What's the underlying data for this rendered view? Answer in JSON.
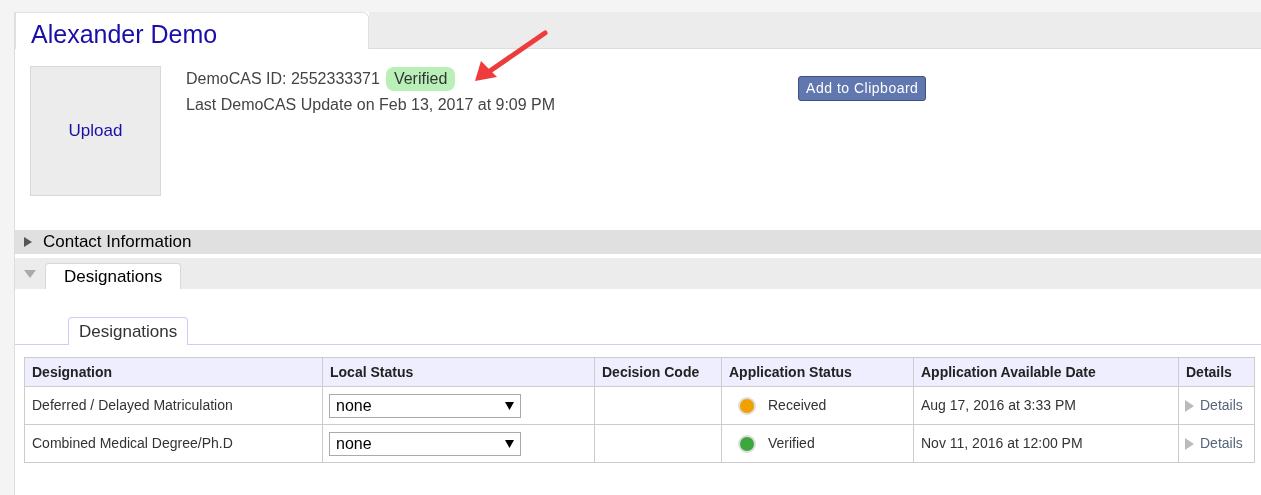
{
  "profile": {
    "name": "Alexander Demo",
    "upload": "Upload",
    "id_label": "DemoCAS ID: 2552333371",
    "id_status": "Verified",
    "last_update": "Last DemoCAS Update on Feb 13, 2017 at 9:09 PM",
    "clipboard_button": "Add to Clipboard"
  },
  "sections": [
    {
      "title": "Contact Information",
      "expanded": false
    },
    {
      "title": "Designations",
      "expanded": true
    }
  ],
  "tabs": [
    {
      "label": "Designations",
      "selected": true
    }
  ],
  "table": {
    "columns": [
      "Designation",
      "Local Status",
      "Decision Code",
      "Application Status",
      "Application Available Date",
      "Details"
    ],
    "rows": [
      {
        "designation": "Deferred / Delayed Matriculation",
        "local_status": "none",
        "application_status": "Received",
        "color": "#f0a000",
        "available_date": "Aug 17, 2016 at 3:33 PM",
        "details": "Details"
      },
      {
        "designation": "Combined Medical Degree/Ph.D",
        "local_status": "none",
        "application_status": "Verified",
        "color": "#3ca83c",
        "available_date": "Nov 11, 2016 at 12:00 PM",
        "details": "Details"
      }
    ]
  }
}
